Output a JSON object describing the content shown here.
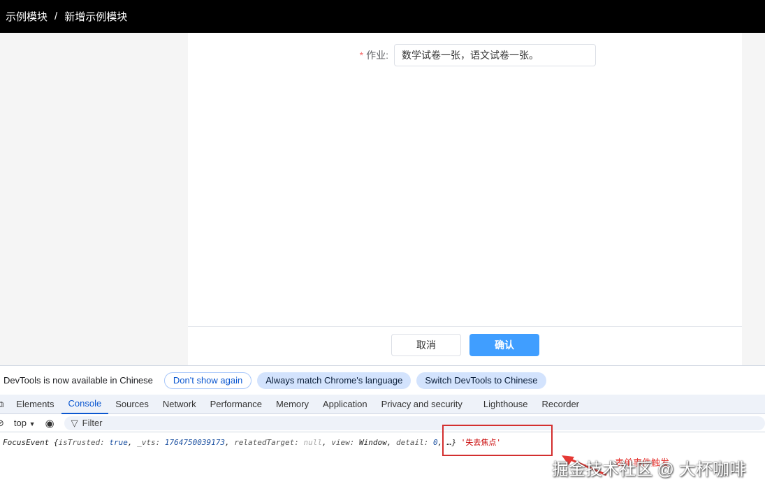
{
  "breadcrumb": {
    "root": "示例模块",
    "separator": "/",
    "current": "新增示例模块"
  },
  "form": {
    "required_mark": "*",
    "homework_label": "作业:",
    "homework_value": "数学试卷一张，语文试卷一张。"
  },
  "footer": {
    "cancel": "取消",
    "confirm": "确认"
  },
  "devtools": {
    "notice": "DevTools is now available in Chinese",
    "buttons": [
      "Don't show again",
      "Always match Chrome's language",
      "Switch DevTools to Chinese"
    ],
    "tabs": [
      "Elements",
      "Console",
      "Sources",
      "Network",
      "Performance",
      "Memory",
      "Application",
      "Privacy and security",
      "Lighthouse",
      "Recorder"
    ],
    "active_tab": "Console",
    "context": "top",
    "filter_placeholder": "Filter",
    "log": {
      "p1": "FocusEvent {",
      "k1": "isTrusted: ",
      "v1": "true",
      "p2": ", ",
      "k2": "_vts: ",
      "v2": "1764750039173",
      "p3": ", ",
      "k3": "relatedTarget: ",
      "v3": "null",
      "p4": ", ",
      "k4": "view: ",
      "v4": "Window",
      "p5": ", ",
      "k5": "detail: ",
      "v5": "0",
      "p6": ", …} ",
      "msg": "'失去焦点'"
    }
  },
  "annotation": "表单事件触发",
  "watermark": "掘金技术社区 @ 大杯咖啡"
}
